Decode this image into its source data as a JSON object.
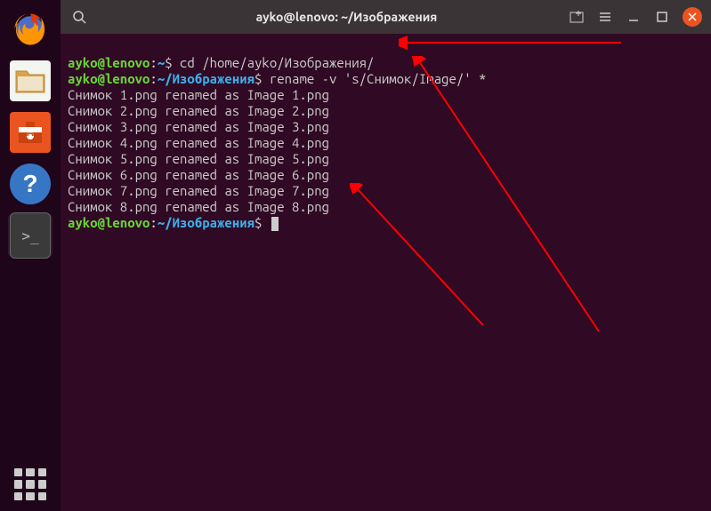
{
  "titlebar": {
    "title": "ayko@lenovo: ~/Изображения"
  },
  "terminal": {
    "prompt1": {
      "user": "ayko@lenovo",
      "colon": ":",
      "path": "~",
      "dollar": "$",
      "command": "cd /home/ayko/Изображения/"
    },
    "prompt2": {
      "user": "ayko@lenovo",
      "colon": ":",
      "tilde": "~",
      "path": "/Изображения",
      "dollar": "$",
      "command": "rename -v 's/Снимок/Image/' *"
    },
    "output": [
      "Снимок 1.png renamed as Image 1.png",
      "Снимок 2.png renamed as Image 2.png",
      "Снимок 3.png renamed as Image 3.png",
      "Снимок 4.png renamed as Image 4.png",
      "Снимок 5.png renamed as Image 5.png",
      "Снимок 6.png renamed as Image 6.png",
      "Снимок 7.png renamed as Image 7.png",
      "Снимок 8.png renamed as Image 8.png"
    ],
    "prompt3": {
      "user": "ayko@lenovo",
      "colon": ":",
      "tilde": "~",
      "path": "/Изображения",
      "dollar": "$"
    }
  },
  "launcher": {
    "help_glyph": "?",
    "term_glyph": ">_"
  }
}
